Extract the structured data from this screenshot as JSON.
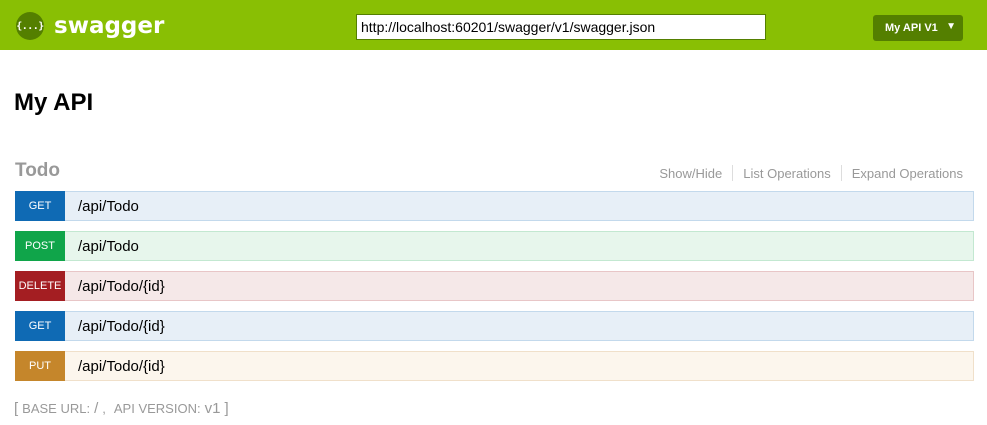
{
  "header": {
    "logo_glyph": "{...}",
    "brand": "swagger",
    "url_value": "http://localhost:60201/swagger/v1/swagger.json",
    "spec_select": "My API V1",
    "accent_color": "#89bf04",
    "dark_accent_color": "#547f00"
  },
  "info": {
    "title": "My API"
  },
  "resource": {
    "name": "Todo",
    "links": [
      "Show/Hide",
      "List Operations",
      "Expand Operations"
    ],
    "operations": [
      {
        "method": "GET",
        "path": "/api/Todo"
      },
      {
        "method": "POST",
        "path": "/api/Todo"
      },
      {
        "method": "DELETE",
        "path": "/api/Todo/{id}"
      },
      {
        "method": "GET",
        "path": "/api/Todo/{id}"
      },
      {
        "method": "PUT",
        "path": "/api/Todo/{id}"
      }
    ]
  },
  "footer": {
    "open_bracket": "[",
    "base_url_label": "BASE URL:",
    "base_url_value": "/",
    "comma": ",",
    "api_version_label": "API VERSION:",
    "api_version_value": "v1",
    "close_bracket": "]"
  },
  "method_colors": {
    "GET": "#0f6ab4",
    "POST": "#10a54a",
    "DELETE": "#a41e22",
    "PUT": "#c5862b"
  }
}
